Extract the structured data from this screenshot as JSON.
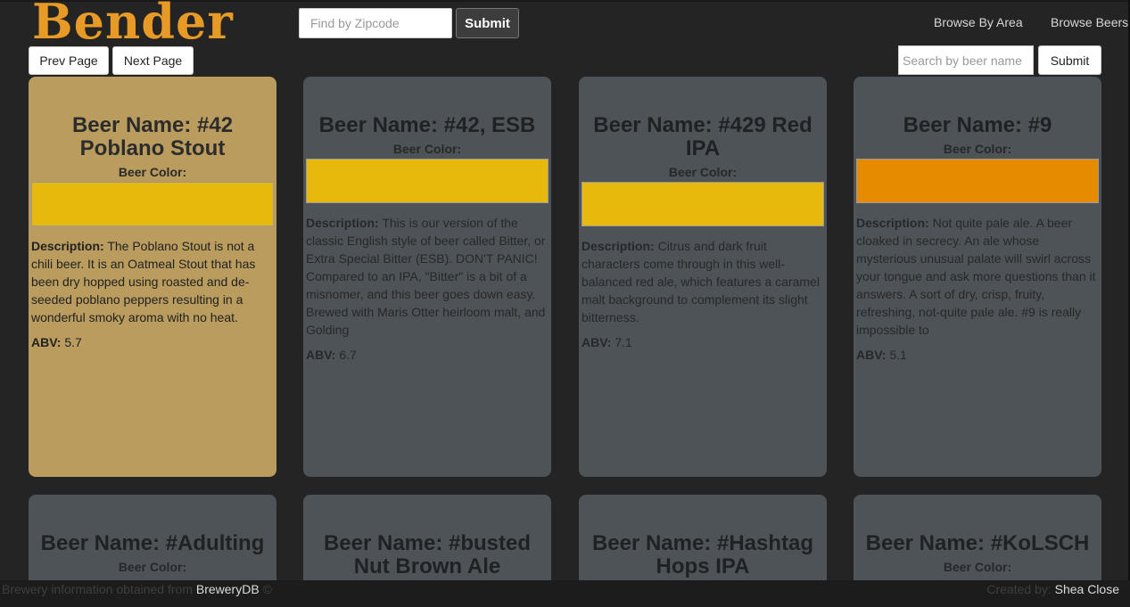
{
  "header": {
    "logo": "Bender",
    "zip_placeholder": "Find by Zipcode",
    "zip_submit": "Submit",
    "nav": [
      "Browse By Area",
      "Browse Beers"
    ]
  },
  "controls": {
    "prev_page": "Prev Page",
    "next_page": "Next Page",
    "beer_search_placeholder": "Search by beer name",
    "beer_search_submit": "Submit"
  },
  "labels": {
    "color": "Beer Color:",
    "description": "Description:",
    "abv": "ABV:"
  },
  "beers": [
    {
      "name": "Beer Name: #42 Poblano Stout",
      "color_hex": "#e6b90c",
      "description": "The Poblano Stout is not a chili beer. It is an Oatmeal Stout that has been dry hopped using roasted and de-seeded poblano peppers resulting in a wonderful smoky aroma with no heat.",
      "abv": "5.7"
    },
    {
      "name": "Beer Name: #42, ESB",
      "color_hex": "#e6b90c",
      "description": "This is our version of the classic English style of beer called Bitter, or Extra Special Bitter (ESB). DON'T PANIC! Compared to an IPA, \"Bitter\" is a bit of a misnomer, and this beer goes down easy. Brewed with Maris Otter heirloom malt, and Golding",
      "abv": "6.7"
    },
    {
      "name": "Beer Name: #429 Red IPA",
      "color_hex": "#e6b90c",
      "description": "Citrus and dark fruit characters come through in this well-balanced red ale, which features a caramel malt background to complement its slight bitterness.",
      "abv": "7.1"
    },
    {
      "name": "Beer Name: #9",
      "color_hex": "#e68a00",
      "description": "Not quite pale ale. A beer cloaked in secrecy. An ale whose mysterious unusual palate will swirl across your tongue and ask more questions than it answers.  A sort of dry, crisp, fruity, refreshing, not-quite pale ale. #9 is really impossible to",
      "abv": "5.1"
    },
    {
      "name": "Beer Name: #Adulting"
    },
    {
      "name": "Beer Name: #busted Nut Brown Ale"
    },
    {
      "name": "Beer Name: #Hashtag Hops IPA"
    },
    {
      "name": "Beer Name: #KoLSCH"
    }
  ],
  "footer": {
    "left_text": "Brewery information obtained from ",
    "left_link": "BreweryDB",
    "left_suffix": " ©",
    "right_text": "Created by: ",
    "right_link": "Shea Close"
  }
}
